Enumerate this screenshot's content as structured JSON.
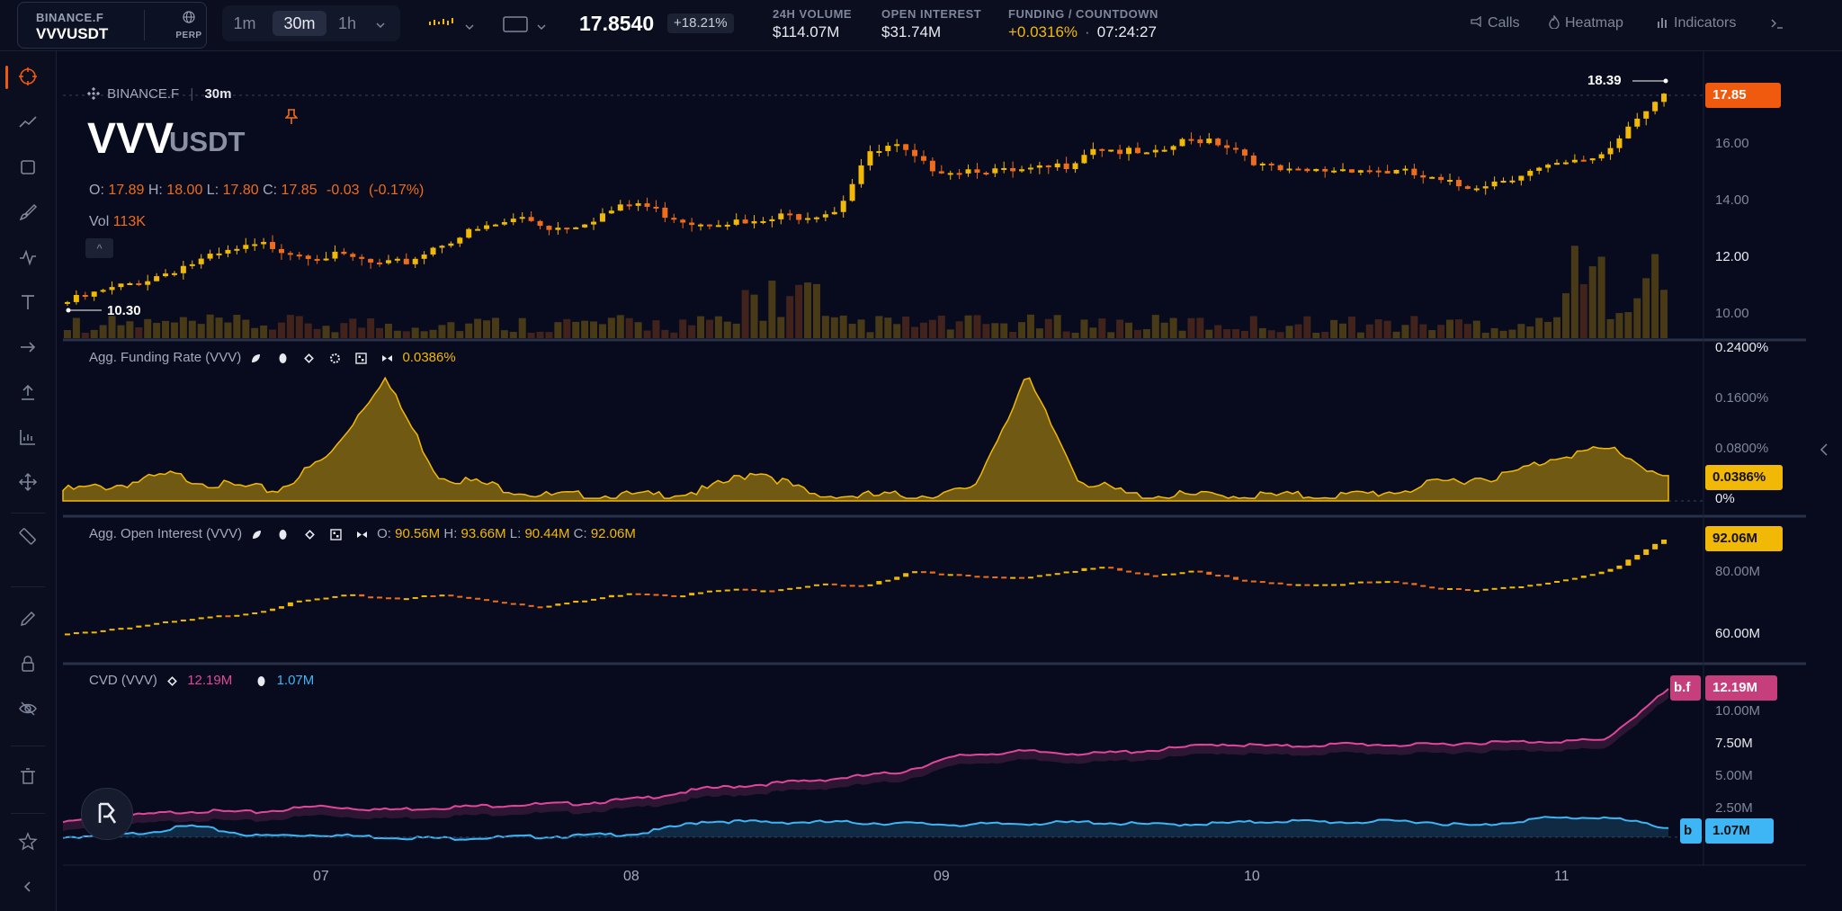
{
  "header": {
    "exchange": "BINANCE.F",
    "pair": "VVVUSDT",
    "contract": "PERP",
    "timeframes": [
      "1m",
      "30m",
      "1h"
    ],
    "active_timeframe": "30m",
    "price": "17.8540",
    "change": "+18.21%",
    "stats": [
      {
        "label": "24H VOLUME",
        "value": "$114.07M"
      },
      {
        "label": "OPEN INTEREST",
        "value": "$31.74M"
      },
      {
        "label": "FUNDING / COUNTDOWN",
        "value": "+0.0316%",
        "extra": "07:24:27"
      }
    ],
    "tools": {
      "calls": "Calls",
      "heatmap": "Heatmap",
      "indicators": "Indicators"
    }
  },
  "legend": {
    "exchange": "BINANCE.F",
    "timeframe": "30m",
    "base": "VVV",
    "quote": "USDT",
    "ohlc": {
      "o_label": "O:",
      "o": "17.89",
      "h_label": "H:",
      "h": "18.00",
      "l_label": "L:",
      "l": "17.80",
      "c_label": "C:",
      "c": "17.85",
      "chg": "-0.03",
      "chg_pct": "(-0.17%)"
    },
    "vol_label": "Vol",
    "vol": "113K",
    "high_marker": "18.39",
    "low_marker": "10.30",
    "collapse": "^"
  },
  "price_axis": [
    "16.00",
    "14.00",
    "12.00",
    "10.00"
  ],
  "price_tag": "17.85",
  "funding": {
    "title": "Agg. Funding Rate (VVV)",
    "value": "0.0386%",
    "axis": [
      "0.2400%",
      "0.1600%",
      "0.0800%",
      "0%"
    ],
    "tag": "0.0386%"
  },
  "oi": {
    "title": "Agg. Open Interest (VVV)",
    "o_label": "O:",
    "o": "90.56M",
    "h_label": "H:",
    "h": "93.66M",
    "l_label": "L:",
    "l": "90.44M",
    "c_label": "C:",
    "c": "92.06M",
    "axis": [
      "80.00M",
      "60.00M"
    ],
    "tag": "92.06M"
  },
  "cvd": {
    "title": "CVD (VVV)",
    "bf_value": "12.19M",
    "b_value": "1.07M",
    "axis": [
      "10.00M",
      "7.50M",
      "5.00M",
      "2.50M"
    ],
    "tag_bf_label": "b.f",
    "tag_bf": "12.19M",
    "tag_b_label": "b",
    "tag_b": "1.07M"
  },
  "x_axis": [
    "07",
    "08",
    "09",
    "10",
    "11"
  ],
  "colors": {
    "bg": "#070b1d",
    "up": "#f2b806",
    "down": "#ef6c1a",
    "cvd_bf": "#e0479a",
    "cvd_b": "#3eb5f4",
    "tag_orange": "#ef5a0f"
  },
  "chart_data": {
    "type": "candlestick",
    "x_ticks": [
      "07",
      "08",
      "09",
      "10",
      "11"
    ],
    "price": [
      10.3,
      10.6,
      10.9,
      11.2,
      11.6,
      11.9,
      12.2,
      12.4,
      12.1,
      12.0,
      11.9,
      11.6,
      11.8,
      12.4,
      12.8,
      13.1,
      13.4,
      13.0,
      13.2,
      13.6,
      13.9,
      13.5,
      13.2,
      13.3,
      13.1,
      13.4,
      13.5,
      13.7,
      15.6,
      16.0,
      15.3,
      15.1,
      15.2,
      15.0,
      15.1,
      15.3,
      16.0,
      15.8,
      15.6,
      16.1,
      16.3,
      15.9,
      15.2,
      15.0,
      15.1,
      15.2,
      15.1,
      15.0,
      14.7,
      14.5,
      14.7,
      15.0,
      15.2,
      15.4,
      15.8,
      17.1,
      17.85
    ],
    "volume_peaks": [
      "09",
      "11"
    ],
    "funding_rate_pct": [
      0.02,
      0.03,
      0.05,
      0.03,
      0.02,
      0.09,
      0.24,
      0.05,
      0.03,
      0.01,
      0.01,
      0.01,
      0.02,
      0.06,
      0.01,
      0.01,
      0.01,
      0.02,
      0.24,
      0.04,
      0.01,
      0.01,
      0.01,
      0.01,
      0.01,
      0.02,
      0.04,
      0.05,
      0.09,
      0.1,
      0.04
    ],
    "open_interest_m": [
      58,
      60,
      62,
      64,
      66,
      70,
      72,
      71,
      72,
      70,
      68,
      70,
      73,
      72,
      74,
      74,
      76,
      75,
      81,
      79,
      78,
      80,
      82,
      79,
      81,
      77,
      76,
      76,
      77,
      75,
      74,
      75,
      78,
      82,
      92
    ],
    "cvd_bf_m": [
      1.5,
      2.0,
      2.4,
      2.3,
      2.8,
      2.5,
      2.7,
      2.9,
      3.0,
      3.4,
      4.2,
      4.6,
      5.0,
      5.5,
      6.9,
      7.2,
      7.0,
      7.3,
      7.8,
      7.6,
      7.8,
      7.7,
      7.9,
      8.0,
      8.1,
      12.19
    ],
    "cvd_b_m": [
      0.3,
      0.5,
      1.2,
      0.4,
      0.5,
      0.3,
      0.2,
      0.3,
      0.4,
      0.6,
      1.6,
      1.5,
      1.5,
      1.4,
      1.3,
      1.4,
      1.5,
      1.3,
      1.4,
      1.6,
      1.5,
      1.6,
      1.2,
      1.8,
      1.9,
      1.07
    ]
  }
}
